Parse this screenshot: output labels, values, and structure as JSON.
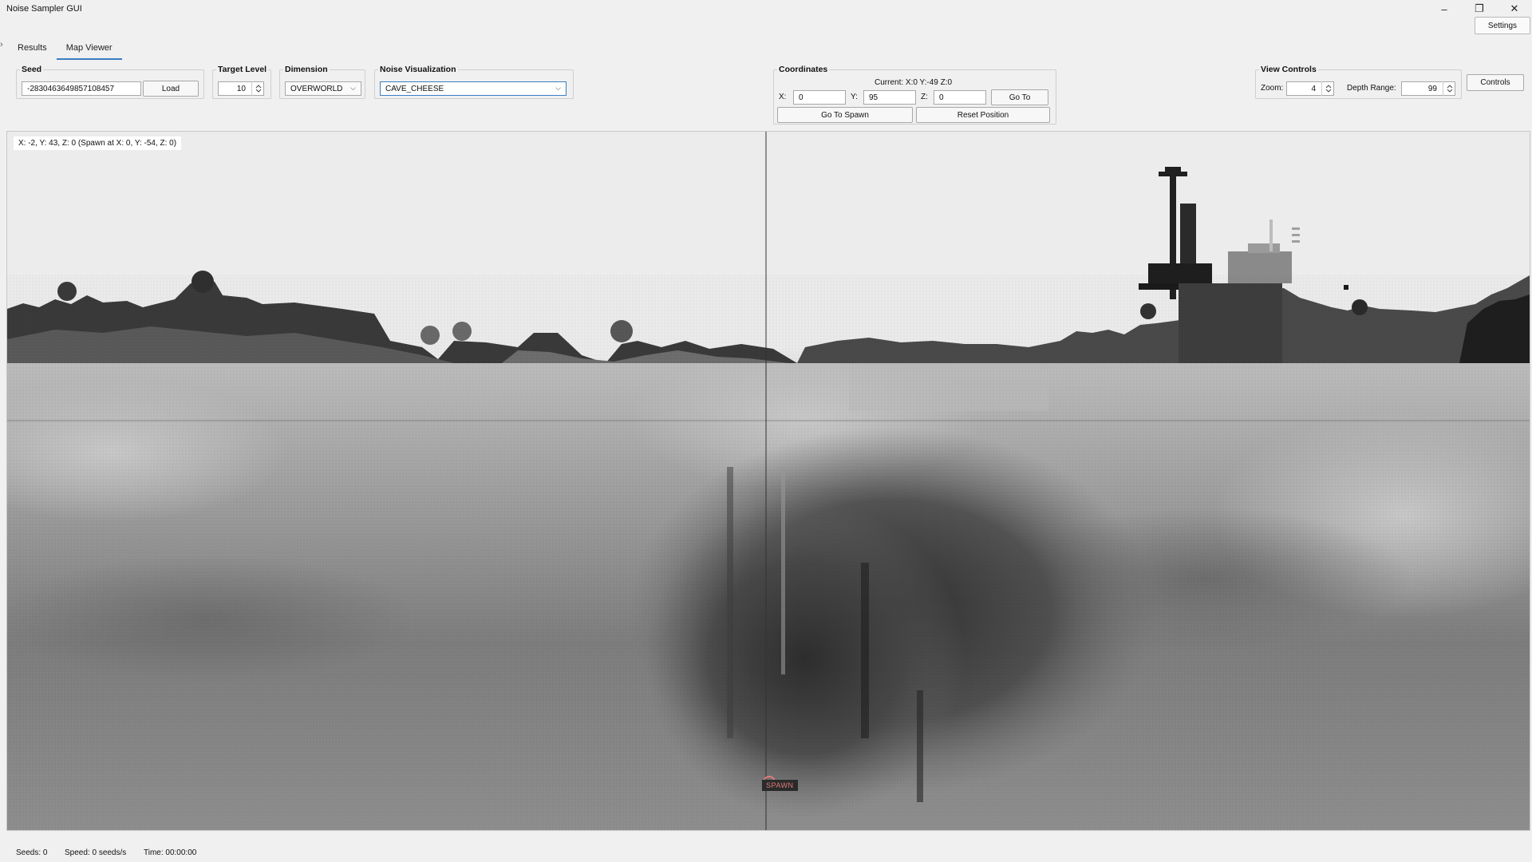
{
  "window": {
    "title": "Noise Sampler GUI",
    "minimize": "–",
    "restore": "❐",
    "close": "✕",
    "settings_label": "Settings"
  },
  "tabs": [
    "Results",
    "Map Viewer"
  ],
  "active_tab": "Map Viewer",
  "seed": {
    "legend": "Seed",
    "value": "-2830463649857108457",
    "load_label": "Load"
  },
  "target_level": {
    "legend": "Target Level",
    "value": "10"
  },
  "dimension": {
    "legend": "Dimension",
    "value": "OVERWORLD"
  },
  "noise_viz": {
    "legend": "Noise Visualization",
    "value": "CAVE_CHEESE"
  },
  "coordinates": {
    "legend": "Coordinates",
    "current": "Current: X:0 Y:-49 Z:0",
    "x_label": "X:",
    "x_value": "0",
    "y_label": "Y:",
    "y_value": "95",
    "z_label": "Z:",
    "z_value": "0",
    "goto_label": "Go To",
    "goto_spawn_label": "Go To Spawn",
    "reset_label": "Reset Position"
  },
  "view_controls": {
    "legend": "View Controls",
    "zoom_label": "Zoom:",
    "zoom_value": "4",
    "depth_label": "Depth Range:",
    "depth_value": "99"
  },
  "controls_label": "Controls",
  "map": {
    "readout": "X: -2, Y: 43, Z: 0 (Spawn at X: 0, Y: -54, Z: 0)",
    "spawn_label": "SPAWN",
    "colors": {
      "sky": "#ececec",
      "terrain_dark": "#202020",
      "fog": "#8a8a8a",
      "spawn": "#e07a7a"
    }
  },
  "status": {
    "seeds": "Seeds: 0",
    "speed": "Speed: 0 seeds/s",
    "time": "Time: 00:00:00"
  }
}
